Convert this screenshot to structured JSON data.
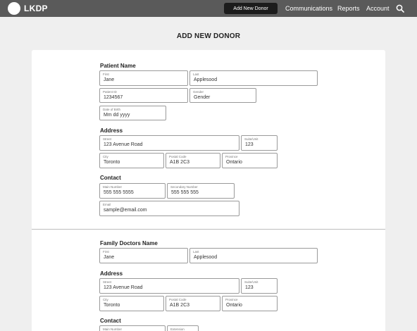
{
  "header": {
    "brand": "LKDP",
    "add_donor_label": "Add New Donor",
    "nav": [
      "Communications",
      "Reports",
      "Account"
    ]
  },
  "page": {
    "title": "ADD NEW DONOR"
  },
  "patient": {
    "title": "Patient Name",
    "first": {
      "label": "First",
      "value": "Jane"
    },
    "last": {
      "label": "Last",
      "value": "Applesood"
    },
    "patient_id": {
      "label": "Patient ID",
      "value": "1234567"
    },
    "gender": {
      "label": "Gender",
      "value": "Gender"
    },
    "dob": {
      "label": "Date of Birth",
      "value": "Mm dd yyyy"
    }
  },
  "address1": {
    "title": "Address",
    "street": {
      "label": "Street",
      "value": "123 Avenue Road"
    },
    "suite": {
      "label": "Suite/Unit",
      "value": "123"
    },
    "city": {
      "label": "City",
      "value": "Toronto"
    },
    "postal": {
      "label": "Postal Code",
      "value": "A1B 2C3"
    },
    "province": {
      "label": "Province",
      "value": "Ontario"
    }
  },
  "contact1": {
    "title": "Contact",
    "main": {
      "label": "Main Number",
      "value": "555 555 5555"
    },
    "secondary": {
      "label": "Secondary Number",
      "value": "555 555 555"
    },
    "email": {
      "label": "Email",
      "value": "sample@email.com"
    }
  },
  "doctor": {
    "title": "Family Doctors Name",
    "first": {
      "label": "First",
      "value": "Jane"
    },
    "last": {
      "label": "Last",
      "value": "Applesood"
    }
  },
  "address2": {
    "title": "Address",
    "street": {
      "label": "Street",
      "value": "123 Avenue Road"
    },
    "suite": {
      "label": "Suite/Unit",
      "value": "123"
    },
    "city": {
      "label": "City",
      "value": "Toronto"
    },
    "postal": {
      "label": "Postal Code",
      "value": "A1B 2C3"
    },
    "province": {
      "label": "Province",
      "value": "Ontario"
    }
  },
  "contact2": {
    "title": "Contact",
    "main": {
      "label": "Main Number",
      "value": ""
    },
    "extension": {
      "label": "Extension",
      "value": ""
    }
  },
  "icons": {
    "search": "search-icon",
    "logo": "logo-circle"
  },
  "colors": {
    "header_bg": "#5a5a5a",
    "button_bg": "#1c1c1c",
    "page_bg": "#efefef"
  }
}
